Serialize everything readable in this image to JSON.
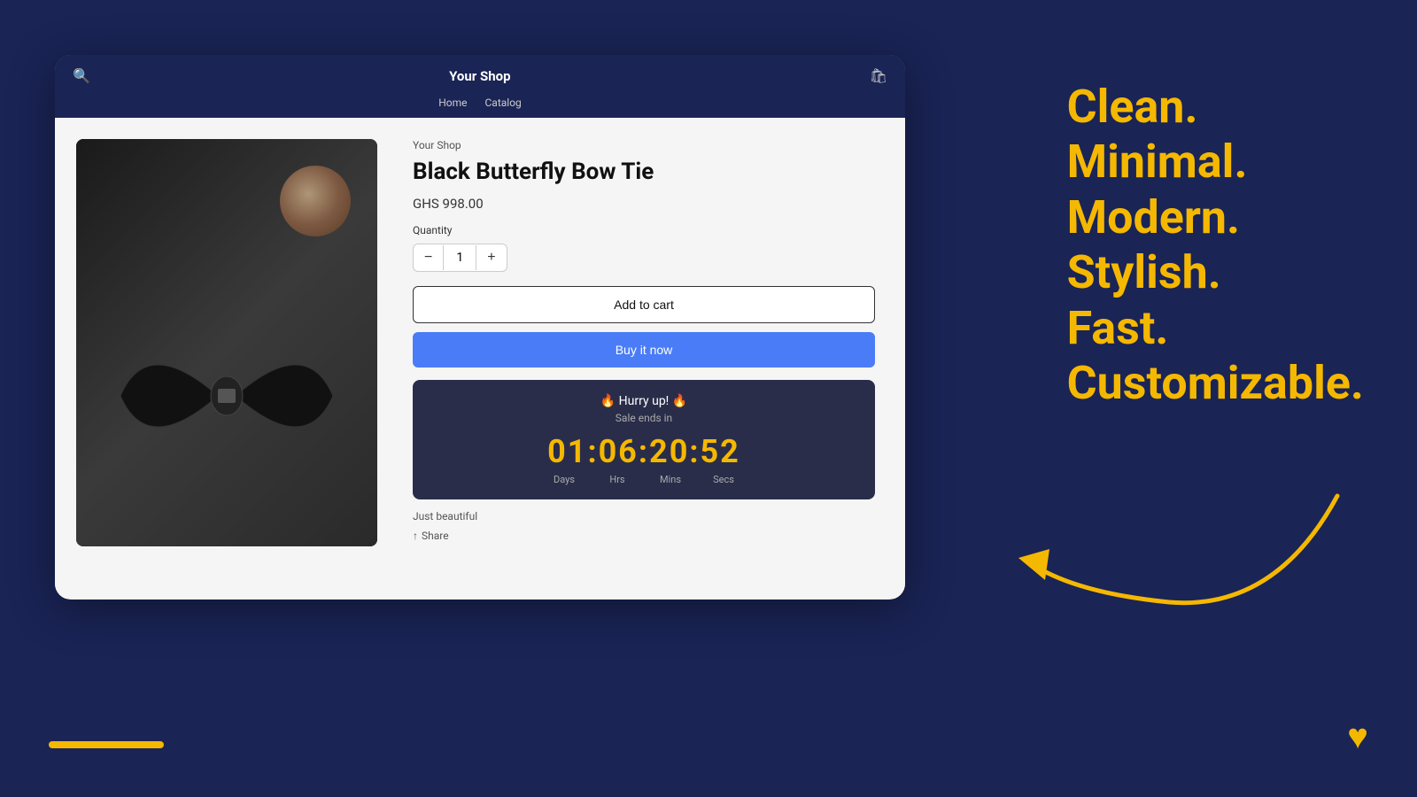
{
  "background": {
    "color": "#1a2455"
  },
  "tagline": {
    "lines": [
      "Clean.",
      "Minimal.",
      "Modern.",
      "Stylish.",
      "Fast.",
      "Customizable."
    ],
    "color": "#f5b800"
  },
  "browser": {
    "title": "Your Shop",
    "nav_links": [
      "Home",
      "Catalog"
    ],
    "search_icon": "🔍",
    "cart_icon": "🛒"
  },
  "product": {
    "brand": "Your Shop",
    "title": "Black Butterfly Bow Tie",
    "price": "GHS 998.00",
    "quantity_label": "Quantity",
    "quantity_value": "1",
    "add_to_cart_label": "Add to cart",
    "buy_now_label": "Buy it now",
    "description": "Just beautiful",
    "share_label": "Share"
  },
  "countdown": {
    "hurry_text": "🔥 Hurry up! 🔥",
    "sale_text": "Sale ends in",
    "timer": "01:06:20:52",
    "labels": [
      "Days",
      "Hrs",
      "Mins",
      "Secs"
    ]
  },
  "decorations": {
    "bar_color": "#f5b800",
    "heart_color": "#f5b800",
    "heart_icon": "♥"
  }
}
